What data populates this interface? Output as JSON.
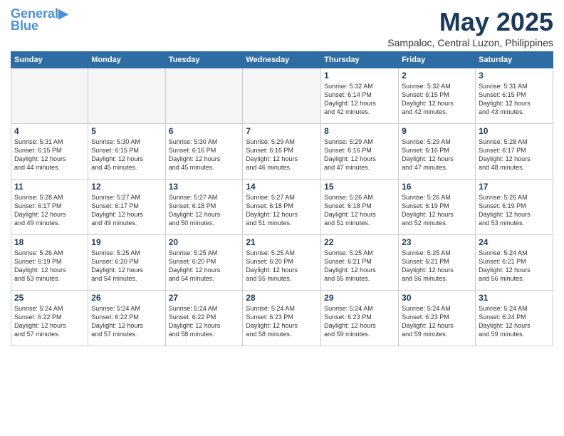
{
  "header": {
    "logo_line1": "General",
    "logo_line2": "Blue",
    "title": "May 2025",
    "subtitle": "Sampaloc, Central Luzon, Philippines"
  },
  "weekdays": [
    "Sunday",
    "Monday",
    "Tuesday",
    "Wednesday",
    "Thursday",
    "Friday",
    "Saturday"
  ],
  "weeks": [
    [
      {
        "day": "",
        "info": "",
        "empty": true
      },
      {
        "day": "",
        "info": "",
        "empty": true
      },
      {
        "day": "",
        "info": "",
        "empty": true
      },
      {
        "day": "",
        "info": "",
        "empty": true
      },
      {
        "day": "1",
        "info": "Sunrise: 5:32 AM\nSunset: 6:14 PM\nDaylight: 12 hours\nand 42 minutes.",
        "empty": false
      },
      {
        "day": "2",
        "info": "Sunrise: 5:32 AM\nSunset: 6:15 PM\nDaylight: 12 hours\nand 42 minutes.",
        "empty": false
      },
      {
        "day": "3",
        "info": "Sunrise: 5:31 AM\nSunset: 6:15 PM\nDaylight: 12 hours\nand 43 minutes.",
        "empty": false
      }
    ],
    [
      {
        "day": "4",
        "info": "Sunrise: 5:31 AM\nSunset: 6:15 PM\nDaylight: 12 hours\nand 44 minutes.",
        "empty": false
      },
      {
        "day": "5",
        "info": "Sunrise: 5:30 AM\nSunset: 6:15 PM\nDaylight: 12 hours\nand 45 minutes.",
        "empty": false
      },
      {
        "day": "6",
        "info": "Sunrise: 5:30 AM\nSunset: 6:16 PM\nDaylight: 12 hours\nand 45 minutes.",
        "empty": false
      },
      {
        "day": "7",
        "info": "Sunrise: 5:29 AM\nSunset: 6:16 PM\nDaylight: 12 hours\nand 46 minutes.",
        "empty": false
      },
      {
        "day": "8",
        "info": "Sunrise: 5:29 AM\nSunset: 6:16 PM\nDaylight: 12 hours\nand 47 minutes.",
        "empty": false
      },
      {
        "day": "9",
        "info": "Sunrise: 5:29 AM\nSunset: 6:16 PM\nDaylight: 12 hours\nand 47 minutes.",
        "empty": false
      },
      {
        "day": "10",
        "info": "Sunrise: 5:28 AM\nSunset: 6:17 PM\nDaylight: 12 hours\nand 48 minutes.",
        "empty": false
      }
    ],
    [
      {
        "day": "11",
        "info": "Sunrise: 5:28 AM\nSunset: 6:17 PM\nDaylight: 12 hours\nand 49 minutes.",
        "empty": false
      },
      {
        "day": "12",
        "info": "Sunrise: 5:27 AM\nSunset: 6:17 PM\nDaylight: 12 hours\nand 49 minutes.",
        "empty": false
      },
      {
        "day": "13",
        "info": "Sunrise: 5:27 AM\nSunset: 6:18 PM\nDaylight: 12 hours\nand 50 minutes.",
        "empty": false
      },
      {
        "day": "14",
        "info": "Sunrise: 5:27 AM\nSunset: 6:18 PM\nDaylight: 12 hours\nand 51 minutes.",
        "empty": false
      },
      {
        "day": "15",
        "info": "Sunrise: 5:26 AM\nSunset: 6:18 PM\nDaylight: 12 hours\nand 51 minutes.",
        "empty": false
      },
      {
        "day": "16",
        "info": "Sunrise: 5:26 AM\nSunset: 6:19 PM\nDaylight: 12 hours\nand 52 minutes.",
        "empty": false
      },
      {
        "day": "17",
        "info": "Sunrise: 5:26 AM\nSunset: 6:19 PM\nDaylight: 12 hours\nand 53 minutes.",
        "empty": false
      }
    ],
    [
      {
        "day": "18",
        "info": "Sunrise: 5:26 AM\nSunset: 6:19 PM\nDaylight: 12 hours\nand 53 minutes.",
        "empty": false
      },
      {
        "day": "19",
        "info": "Sunrise: 5:25 AM\nSunset: 6:20 PM\nDaylight: 12 hours\nand 54 minutes.",
        "empty": false
      },
      {
        "day": "20",
        "info": "Sunrise: 5:25 AM\nSunset: 6:20 PM\nDaylight: 12 hours\nand 54 minutes.",
        "empty": false
      },
      {
        "day": "21",
        "info": "Sunrise: 5:25 AM\nSunset: 6:20 PM\nDaylight: 12 hours\nand 55 minutes.",
        "empty": false
      },
      {
        "day": "22",
        "info": "Sunrise: 5:25 AM\nSunset: 6:21 PM\nDaylight: 12 hours\nand 55 minutes.",
        "empty": false
      },
      {
        "day": "23",
        "info": "Sunrise: 5:25 AM\nSunset: 6:21 PM\nDaylight: 12 hours\nand 56 minutes.",
        "empty": false
      },
      {
        "day": "24",
        "info": "Sunrise: 5:24 AM\nSunset: 6:21 PM\nDaylight: 12 hours\nand 56 minutes.",
        "empty": false
      }
    ],
    [
      {
        "day": "25",
        "info": "Sunrise: 5:24 AM\nSunset: 6:22 PM\nDaylight: 12 hours\nand 57 minutes.",
        "empty": false
      },
      {
        "day": "26",
        "info": "Sunrise: 5:24 AM\nSunset: 6:22 PM\nDaylight: 12 hours\nand 57 minutes.",
        "empty": false
      },
      {
        "day": "27",
        "info": "Sunrise: 5:24 AM\nSunset: 6:22 PM\nDaylight: 12 hours\nand 58 minutes.",
        "empty": false
      },
      {
        "day": "28",
        "info": "Sunrise: 5:24 AM\nSunset: 6:23 PM\nDaylight: 12 hours\nand 58 minutes.",
        "empty": false
      },
      {
        "day": "29",
        "info": "Sunrise: 5:24 AM\nSunset: 6:23 PM\nDaylight: 12 hours\nand 59 minutes.",
        "empty": false
      },
      {
        "day": "30",
        "info": "Sunrise: 5:24 AM\nSunset: 6:23 PM\nDaylight: 12 hours\nand 59 minutes.",
        "empty": false
      },
      {
        "day": "31",
        "info": "Sunrise: 5:24 AM\nSunset: 6:24 PM\nDaylight: 12 hours\nand 59 minutes.",
        "empty": false
      }
    ]
  ]
}
